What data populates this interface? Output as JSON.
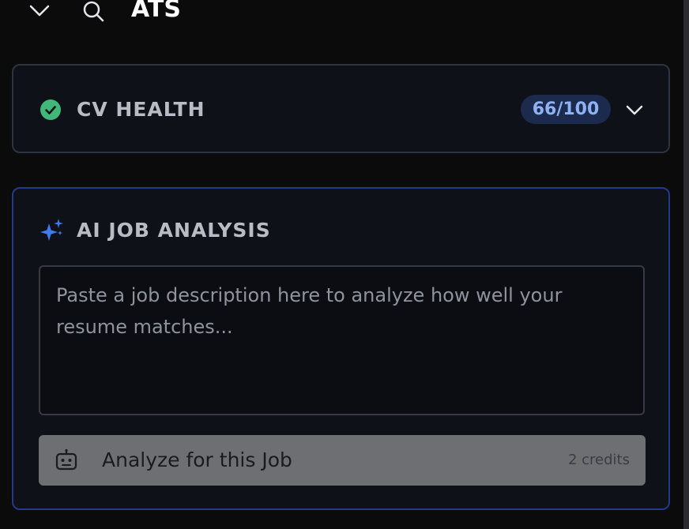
{
  "header": {
    "title": "ATS"
  },
  "cv_health": {
    "label": "CV HEALTH",
    "score": "66/100",
    "status_color": "#3fb87a"
  },
  "ai_job_analysis": {
    "label": "AI JOB ANALYSIS",
    "textarea_placeholder": "Paste a job description here to analyze how well your resume matches...",
    "textarea_value": "",
    "analyze_button_label": "Analyze for this Job",
    "credits_label": "2 credits",
    "accent_color": "#3f7bf0"
  }
}
